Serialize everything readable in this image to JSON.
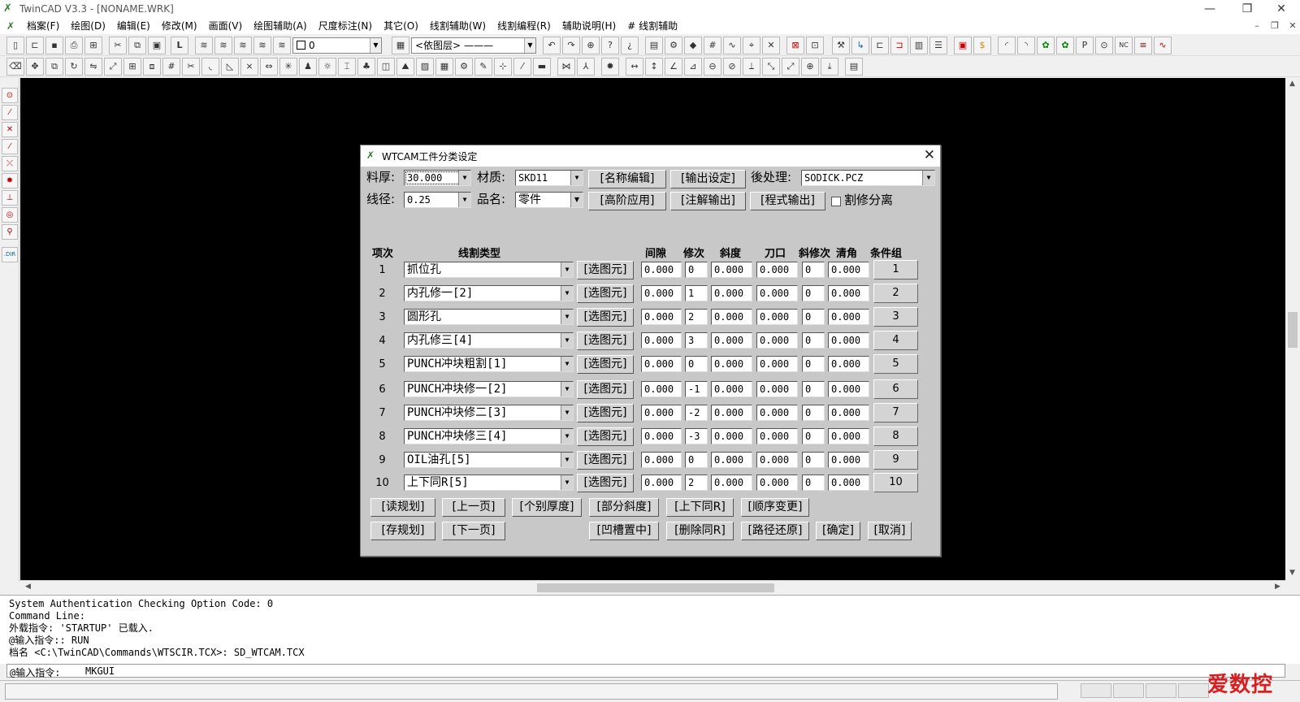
{
  "window": {
    "title": "TwinCAD V3.3 - [NONAME.WRK]"
  },
  "menu": [
    "档案(F)",
    "绘图(D)",
    "编辑(E)",
    "修改(M)",
    "画面(V)",
    "绘图辅助(A)",
    "尺度标注(N)",
    "其它(O)",
    "线割辅助(W)",
    "线割编程(R)",
    "辅助说明(H)",
    "# 线割辅助"
  ],
  "toolbar": {
    "layer_value": "0",
    "layer_mode": "<依图层>",
    "l_label": "L"
  },
  "dialog": {
    "title": "WTCAM工件分类设定",
    "thickness_label": "料厚:",
    "thickness_value": "30.000",
    "material_label": "材质:",
    "material_value": "SKD11",
    "wire_label": "线径:",
    "wire_value": "0.25",
    "partname_label": "品名:",
    "partname_value": "零件",
    "postproc_label": "後处理:",
    "postproc_value": "SODICK.PCZ",
    "checkbox_label": "割修分离",
    "top_buttons": [
      "[名称编辑]",
      "[输出设定]",
      "[高阶应用]",
      "[注解输出]",
      "[程式输出]"
    ],
    "headers": {
      "item": "项次",
      "type": "线割类型",
      "gap": "间隙",
      "trim": "修次",
      "slope": "斜度",
      "blade": "刀口",
      "slope_trim": "斜修次",
      "clear": "清角",
      "cond": "条件组"
    },
    "select_label": "[选图元]",
    "rows": [
      {
        "n": "1",
        "type": "抓位孔",
        "gap": "0.000",
        "trim": "0",
        "slope": "0.000",
        "blade": "0.000",
        "st": "0",
        "clear": "0.000",
        "cond": "1"
      },
      {
        "n": "2",
        "type": "内孔修一[2]",
        "gap": "0.000",
        "trim": "1",
        "slope": "0.000",
        "blade": "0.000",
        "st": "0",
        "clear": "0.000",
        "cond": "2"
      },
      {
        "n": "3",
        "type": "圆形孔",
        "gap": "0.000",
        "trim": "2",
        "slope": "0.000",
        "blade": "0.000",
        "st": "0",
        "clear": "0.000",
        "cond": "3"
      },
      {
        "n": "4",
        "type": "内孔修三[4]",
        "gap": "0.000",
        "trim": "3",
        "slope": "0.000",
        "blade": "0.000",
        "st": "0",
        "clear": "0.000",
        "cond": "4"
      },
      {
        "n": "5",
        "type": "PUNCH冲块粗割[1]",
        "gap": "0.000",
        "trim": "0",
        "slope": "0.000",
        "blade": "0.000",
        "st": "0",
        "clear": "0.000",
        "cond": "5"
      },
      {
        "n": "6",
        "type": "PUNCH冲块修一[2]",
        "gap": "0.000",
        "trim": "-1",
        "slope": "0.000",
        "blade": "0.000",
        "st": "0",
        "clear": "0.000",
        "cond": "6"
      },
      {
        "n": "7",
        "type": "PUNCH冲块修二[3]",
        "gap": "0.000",
        "trim": "-2",
        "slope": "0.000",
        "blade": "0.000",
        "st": "0",
        "clear": "0.000",
        "cond": "7"
      },
      {
        "n": "8",
        "type": "PUNCH冲块修三[4]",
        "gap": "0.000",
        "trim": "-3",
        "slope": "0.000",
        "blade": "0.000",
        "st": "0",
        "clear": "0.000",
        "cond": "8"
      },
      {
        "n": "9",
        "type": "OIL油孔[5]",
        "gap": "0.000",
        "trim": "0",
        "slope": "0.000",
        "blade": "0.000",
        "st": "0",
        "clear": "0.000",
        "cond": "9"
      },
      {
        "n": "10",
        "type": "上下同R[5]",
        "gap": "0.000",
        "trim": "2",
        "slope": "0.000",
        "blade": "0.000",
        "st": "0",
        "clear": "0.000",
        "cond": "10"
      }
    ],
    "bottom_row1": [
      "[读规划]",
      "[上一页]",
      "[个别厚度]",
      "[部分斜度]",
      "[上下同R]",
      "[顺序变更]"
    ],
    "bottom_row2": [
      "[存规划]",
      "[下一页]",
      "[凹槽置中]",
      "[删除同R]",
      "[路径还原]",
      "[确定]",
      "[取消]"
    ]
  },
  "command": {
    "lines": [
      "System Authentication Checking Option Code: 0",
      "Command Line:",
      "外载指令: 'STARTUP' 已载入.",
      "@输入指令:: RUN",
      "档名 <C:\\TwinCAD\\Commands\\WTSCIR.TCX>: SD_WTCAM.TCX"
    ],
    "prompt": "@输入指令:",
    "input_value": "MKGUI"
  },
  "watermark": "爱数控"
}
